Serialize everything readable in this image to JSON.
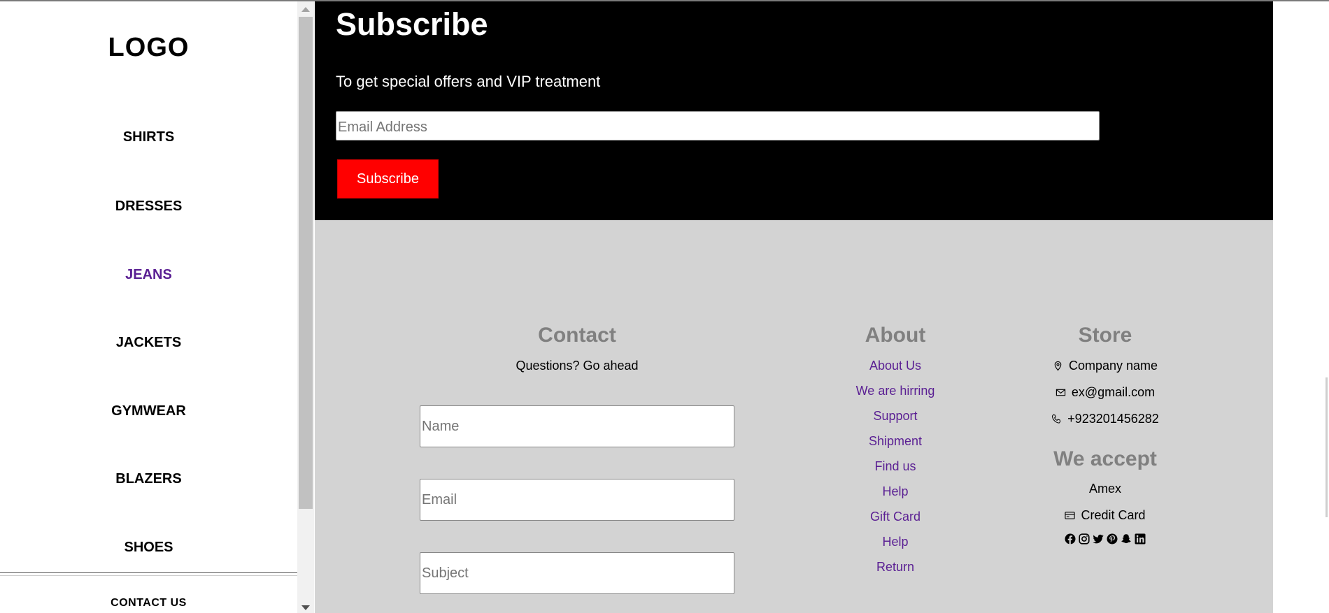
{
  "sidebar": {
    "logo": "LOGO",
    "nav": [
      {
        "label": "SHIRTS",
        "active": false
      },
      {
        "label": "DRESSES",
        "active": false
      },
      {
        "label": "JEANS",
        "active": true
      },
      {
        "label": "JACKETS",
        "active": false
      },
      {
        "label": "GYMWEAR",
        "active": false
      },
      {
        "label": "BLAZERS",
        "active": false
      },
      {
        "label": "SHOES",
        "active": false
      }
    ],
    "contact_label": "CONTACT US"
  },
  "subscribe": {
    "title": "Subscribe",
    "description": "To get special offers and VIP treatment",
    "email_placeholder": "Email Address",
    "button_label": "Subscribe"
  },
  "footer": {
    "contact": {
      "title": "Contact",
      "subtitle": "Questions? Go ahead",
      "name_placeholder": "Name",
      "email_placeholder": "Email",
      "subject_placeholder": "Subject"
    },
    "about": {
      "title": "About",
      "links": [
        "About Us",
        "We are hirring",
        "Support",
        "Shipment",
        "Find us",
        "Help",
        "Gift Card",
        "Help",
        "Return"
      ]
    },
    "store": {
      "title": "Store",
      "company": "Company name",
      "email": "ex@gmail.com",
      "phone": "+923201456282",
      "accept_title": "We accept",
      "payment_1": "Amex",
      "payment_2": "Credit Card",
      "social_icons": [
        "facebook-icon",
        "instagram-icon",
        "twitter-icon",
        "pinterest-icon",
        "snapchat-icon",
        "linkedin-icon"
      ]
    }
  },
  "colors": {
    "active_nav": "#5a1f93",
    "link": "#5a1f93",
    "subscribe_bg": "#000000",
    "subscribe_button": "#ff0000",
    "footer_bg": "#d3d3d3",
    "heading_gray": "#808080"
  }
}
